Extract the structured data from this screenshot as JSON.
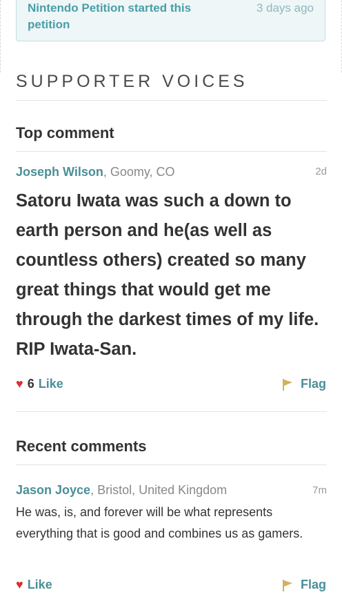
{
  "petition_banner": {
    "text": "Nintendo Petition started this petition",
    "time": "3 days ago"
  },
  "supporter_voices": {
    "heading": "SUPPORTER VOICES",
    "top_comment": {
      "heading": "Top comment",
      "author": "Joseph Wilson",
      "location": ", Goomy, CO",
      "time": "2d",
      "body": "Satoru Iwata was such a down to earth person and he(as well as countless others) created so many great things that would get me through the darkest times of my life. RIP Iwata-San.",
      "like_count": "6",
      "like_label": "Like",
      "flag_label": "Flag"
    },
    "recent_comments": {
      "heading": "Recent comments",
      "items": [
        {
          "author": "Jason Joyce",
          "location": ", Bristol, United Kingdom",
          "time": "7m",
          "body": "He was, is, and forever will be what represents everything that is good and combines us as gamers.",
          "like_label": "Like",
          "flag_label": "Flag"
        }
      ]
    }
  },
  "colors": {
    "accent": "#4a8f97",
    "heart": "#d9302c",
    "flag": "#d4b15a"
  },
  "icons": {
    "heart": "heart-icon",
    "flag": "flag-icon"
  }
}
